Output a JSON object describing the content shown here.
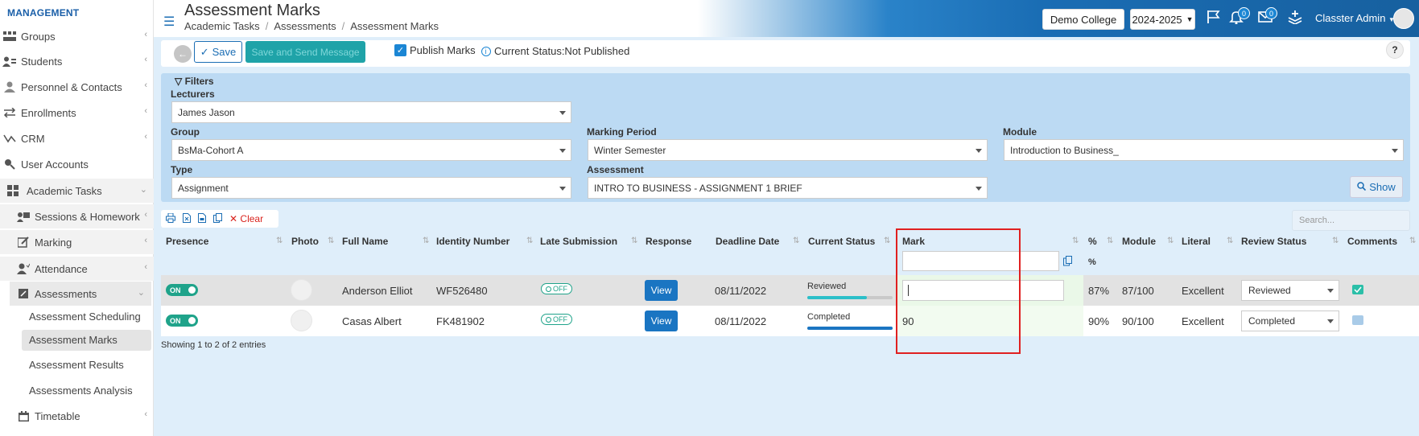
{
  "sidebar": {
    "section_title": "MANAGEMENT",
    "items": [
      {
        "label": "Groups",
        "icon": "groups-icon"
      },
      {
        "label": "Students",
        "icon": "students-icon"
      },
      {
        "label": "Personnel & Contacts",
        "icon": "personnel-icon"
      },
      {
        "label": "Enrollments",
        "icon": "enrollments-icon"
      },
      {
        "label": "CRM",
        "icon": "crm-icon"
      },
      {
        "label": "User Accounts",
        "icon": "key-icon"
      },
      {
        "label": "Academic Tasks",
        "icon": "grid-icon"
      },
      {
        "label": "Sessions & Homework",
        "icon": "sessions-icon"
      },
      {
        "label": "Marking",
        "icon": "marking-icon"
      },
      {
        "label": "Attendance",
        "icon": "attendance-icon"
      },
      {
        "label": "Assessments",
        "icon": "assessments-icon"
      },
      {
        "label": "Assessment Scheduling"
      },
      {
        "label": "Assessment Marks"
      },
      {
        "label": "Assessment Results"
      },
      {
        "label": "Assessments Analysis"
      },
      {
        "label": "Timetable",
        "icon": "calendar-icon"
      }
    ]
  },
  "header": {
    "title": "Assessment Marks",
    "breadcrumb": [
      "Academic Tasks",
      "Assessments",
      "Assessment Marks"
    ],
    "college": "Demo College",
    "year": "2024-2025",
    "notifications_count": "0",
    "messages_count": "0",
    "user_name": "Classter Admin"
  },
  "toolbar": {
    "save_label": "Save",
    "send_label": "Save and Send Message",
    "publish_label": "Publish Marks",
    "status_text": "Current Status:Not Published",
    "help_label": "?"
  },
  "filters": {
    "title": "Filters",
    "lecturers_label": "Lecturers",
    "lecturers_value": "James Jason",
    "group_label": "Group",
    "group_value": "BsMa-Cohort A",
    "marking_period_label": "Marking Period",
    "marking_period_value": "Winter Semester",
    "module_label": "Module",
    "module_value": "Introduction to Business_",
    "type_label": "Type",
    "type_value": "Assignment",
    "assessment_label": "Assessment",
    "assessment_value": "INTRO TO BUSINESS - ASSIGNMENT 1 BRIEF",
    "show_label": "Show"
  },
  "table_tools": {
    "clear_label": "Clear",
    "search_placeholder": "Search..."
  },
  "table": {
    "headers": [
      "Presence",
      "Photo",
      "Full Name",
      "Identity Number",
      "Late Submission",
      "Response",
      "Deadline Date",
      "Current Status",
      "Mark",
      "%",
      "Module",
      "Literal",
      "Review Status",
      "Comments"
    ],
    "percent_filter": "%",
    "rows": [
      {
        "presence": "ON",
        "full_name": "Anderson Elliot",
        "identity": "WF526480",
        "late": "OFF",
        "response": "View",
        "deadline": "08/11/2022",
        "status": "Reviewed",
        "status_progress": 0.7,
        "mark": "",
        "percent": "87%",
        "module": "87/100",
        "literal": "Excellent",
        "review_status": "Reviewed"
      },
      {
        "presence": "ON",
        "full_name": "Casas Albert",
        "identity": "FK481902",
        "late": "OFF",
        "response": "View",
        "deadline": "08/11/2022",
        "status": "Completed",
        "status_progress": 1.0,
        "mark": "90",
        "percent": "90%",
        "module": "90/100",
        "literal": "Excellent",
        "review_status": "Completed"
      }
    ],
    "footer": "Showing 1 to 2 of 2 entries"
  },
  "colors": {
    "brand": "#1a6db4",
    "teal": "#1fa3a8",
    "status_reviewed": "#2bbfc9",
    "status_completed": "#1a75c2",
    "highlight": "#e02020"
  }
}
